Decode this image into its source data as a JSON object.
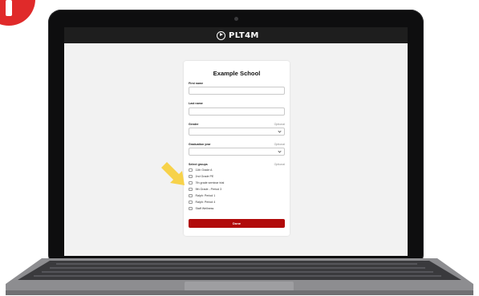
{
  "colors": {
    "accent": "#b10b0b",
    "topbar": "#1e1e1e",
    "badge": "#e02a2a",
    "arrow": "#f7d24a"
  },
  "brand": {
    "name": "PLT4M",
    "logo_icon": "play-circle-icon"
  },
  "form": {
    "title": "Example School",
    "first_name": {
      "label": "First name",
      "value": ""
    },
    "last_name": {
      "label": "Last name",
      "value": ""
    },
    "gender": {
      "label": "Gender",
      "optional": "Optional",
      "value": ""
    },
    "graduation_year": {
      "label": "Graduation year",
      "optional": "Optional",
      "value": ""
    },
    "groups": {
      "label": "Select groups",
      "optional": "Optional",
      "items": [
        {
          "label": "11th Grade A"
        },
        {
          "label": "2nd Grade PE"
        },
        {
          "label": "7th grade seminar trial"
        },
        {
          "label": "9th Grade - Period 3"
        },
        {
          "label": "Ralph: Period 1"
        },
        {
          "label": "Ralph: Period 4"
        },
        {
          "label": "Staff Wellness"
        }
      ]
    },
    "submit_label": "Done"
  },
  "icons": {
    "pointer": "pointer-arrow-icon",
    "chevron": "chevron-down-icon",
    "camera": "camera-icon"
  }
}
